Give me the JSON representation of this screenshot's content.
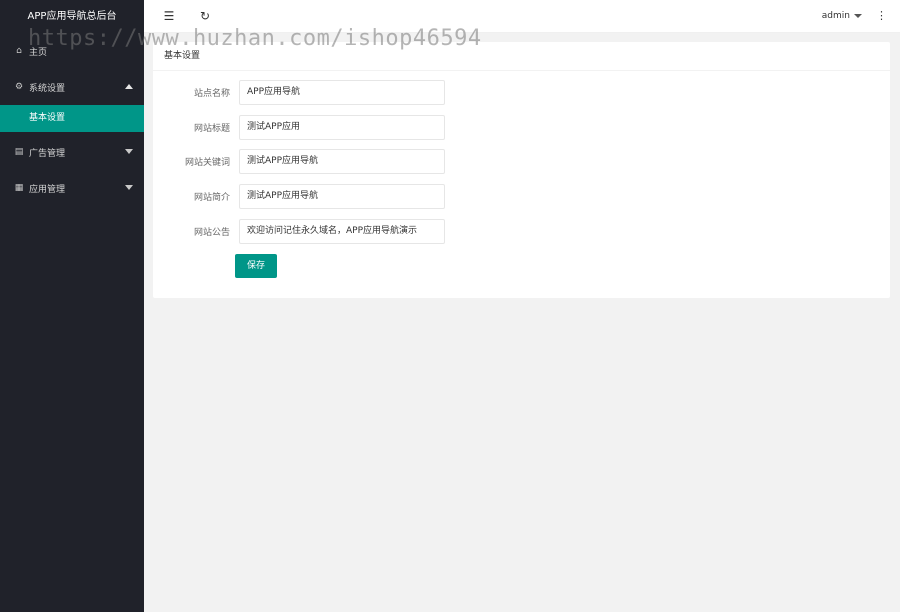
{
  "app": {
    "title": "APP应用导航总后台"
  },
  "sidebar": {
    "items": [
      {
        "label": "主页",
        "icon": "home-icon"
      },
      {
        "label": "系统设置",
        "icon": "gear-icon",
        "expanded": true,
        "sub": [
          {
            "label": "基本设置",
            "active": true
          }
        ]
      },
      {
        "label": "广告管理",
        "icon": "ad-icon",
        "expanded": false
      },
      {
        "label": "应用管理",
        "icon": "app-icon",
        "expanded": false
      }
    ]
  },
  "header": {
    "user": "admin",
    "icons": [
      "menu-fold-icon",
      "refresh-icon",
      "more-vertical-icon"
    ]
  },
  "card": {
    "title": "基本设置",
    "fields": [
      {
        "label": "站点名称",
        "value": "APP应用导航"
      },
      {
        "label": "网站标题",
        "value": "测试APP应用"
      },
      {
        "label": "网站关键词",
        "value": "测试APP应用导航"
      },
      {
        "label": "网站简介",
        "value": "测试APP应用导航"
      },
      {
        "label": "网站公告",
        "value": "欢迎访问记住永久域名，APP应用导航演示"
      }
    ],
    "save_label": "保存"
  },
  "watermark": "https://www.huzhan.com/ishop46594",
  "colors": {
    "accent": "#009688",
    "sidebar_bg": "#20222a",
    "page_bg": "#f2f2f2"
  }
}
